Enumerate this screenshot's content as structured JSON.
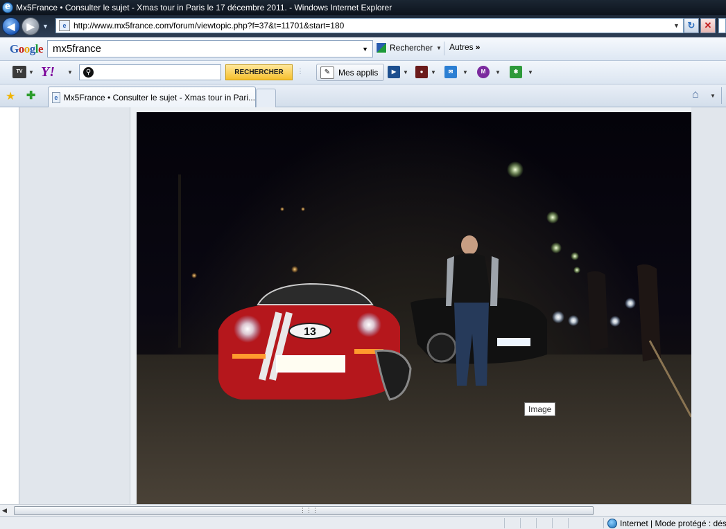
{
  "window": {
    "title": "Mx5France • Consulter le sujet - Xmas tour in Paris le 17 décembre 2011. - Windows Internet Explorer"
  },
  "address_bar": {
    "url": "http://www.mx5france.com/forum/viewtopic.php?f=37&t=11701&start=180"
  },
  "google_toolbar": {
    "logo": "Google",
    "search_value": "mx5france",
    "search_button": "Rechercher",
    "more_button": "Autres"
  },
  "yahoo_toolbar": {
    "tv_label": "TV",
    "logo": "Y!",
    "search_button": "RECHERCHER",
    "apps_button": "Mes applis"
  },
  "tabs": [
    {
      "label": "Mx5France • Consulter le sujet - Xmas tour in Pari..."
    }
  ],
  "page": {
    "photo_tooltip": "Image",
    "photo_plate_number": "13"
  },
  "status_bar": {
    "zone_text": "Internet | Mode protégé : dés"
  },
  "colors": {
    "window_chrome": "#1b2633",
    "toolbar_bg": "#dde7f3",
    "page_bg": "#e1e6ec",
    "yahoo_button": "#f6bf2c"
  },
  "icons": [
    "ie-icon",
    "back-icon",
    "forward-icon",
    "page-icon",
    "refresh-icon",
    "stop-icon",
    "google-icon",
    "tv-icon",
    "yahoo-icon",
    "search-icon",
    "apps-icon",
    "favorites-star-icon",
    "add-favorite-icon",
    "home-icon",
    "globe-icon"
  ]
}
